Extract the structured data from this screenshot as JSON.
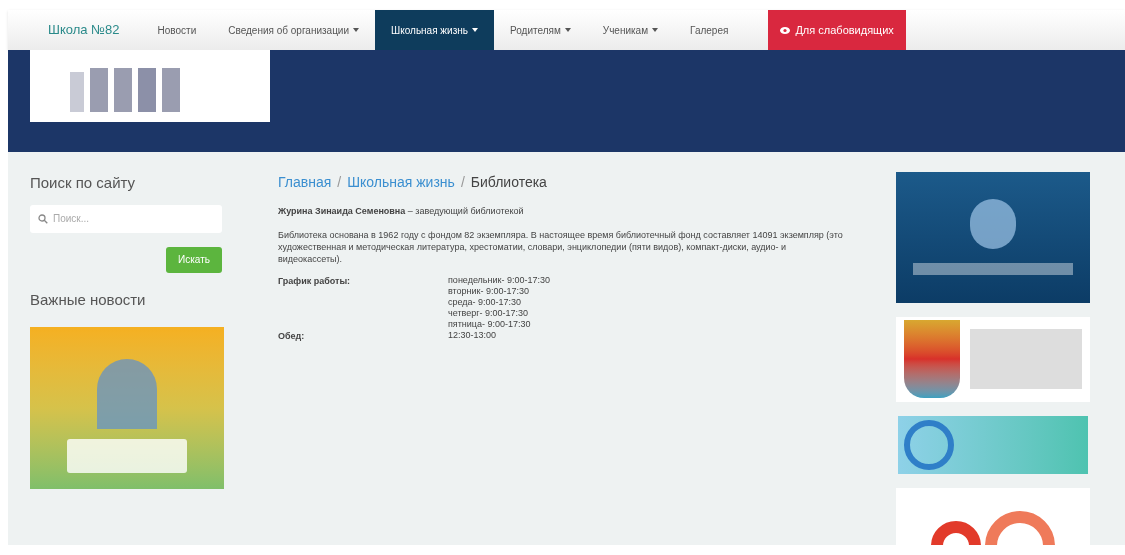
{
  "nav": {
    "brand": "Школа №82",
    "items": [
      {
        "label": "Новости",
        "dropdown": false,
        "selected": false
      },
      {
        "label": "Сведения об организации",
        "dropdown": true,
        "selected": false
      },
      {
        "label": "Школьная жизнь",
        "dropdown": true,
        "selected": true
      },
      {
        "label": "Родителям",
        "dropdown": true,
        "selected": false
      },
      {
        "label": "Ученикам",
        "dropdown": true,
        "selected": false
      },
      {
        "label": "Галерея",
        "dropdown": false,
        "selected": false
      }
    ],
    "accessibility_button": "Для слабовидящих"
  },
  "sidebar": {
    "search_title": "Поиск по сайту",
    "search": {
      "placeholder": "Поиск..."
    },
    "search_button": "Искать",
    "news_title": "Важные новости"
  },
  "content": {
    "breadcrumb_separator": "/",
    "breadcrumbs": [
      {
        "label": "Главная",
        "kind": "link"
      },
      {
        "label": "Школьная жизнь",
        "kind": "link"
      },
      {
        "label": "Библиотека",
        "kind": "current"
      }
    ],
    "librarian": "**Журина Зинаида Семеновна** – заведующий библиотекой",
    "description": "Библиотека основана в 1962 году с фондом 82 экземпляра. В настоящее время библиотечный фонд составляет 14091 экземпляр (это художественная и методическая литература, хрестоматии, словари, энциклопедии (пяти видов), компакт-диски, аудио- и видеокассеты).",
    "schedule": [
      {
        "label": "График работы:",
        "lines": [
          "понедельник- 9:00-17:30",
          "вторник- 9:00-17:30",
          "среда- 9:00-17:30",
          "четверг- 9:00-17:30",
          "пятница- 9:00-17:30"
        ]
      },
      {
        "label": "Обед:",
        "lines": [
          "12:30-13:00"
        ]
      }
    ]
  }
}
